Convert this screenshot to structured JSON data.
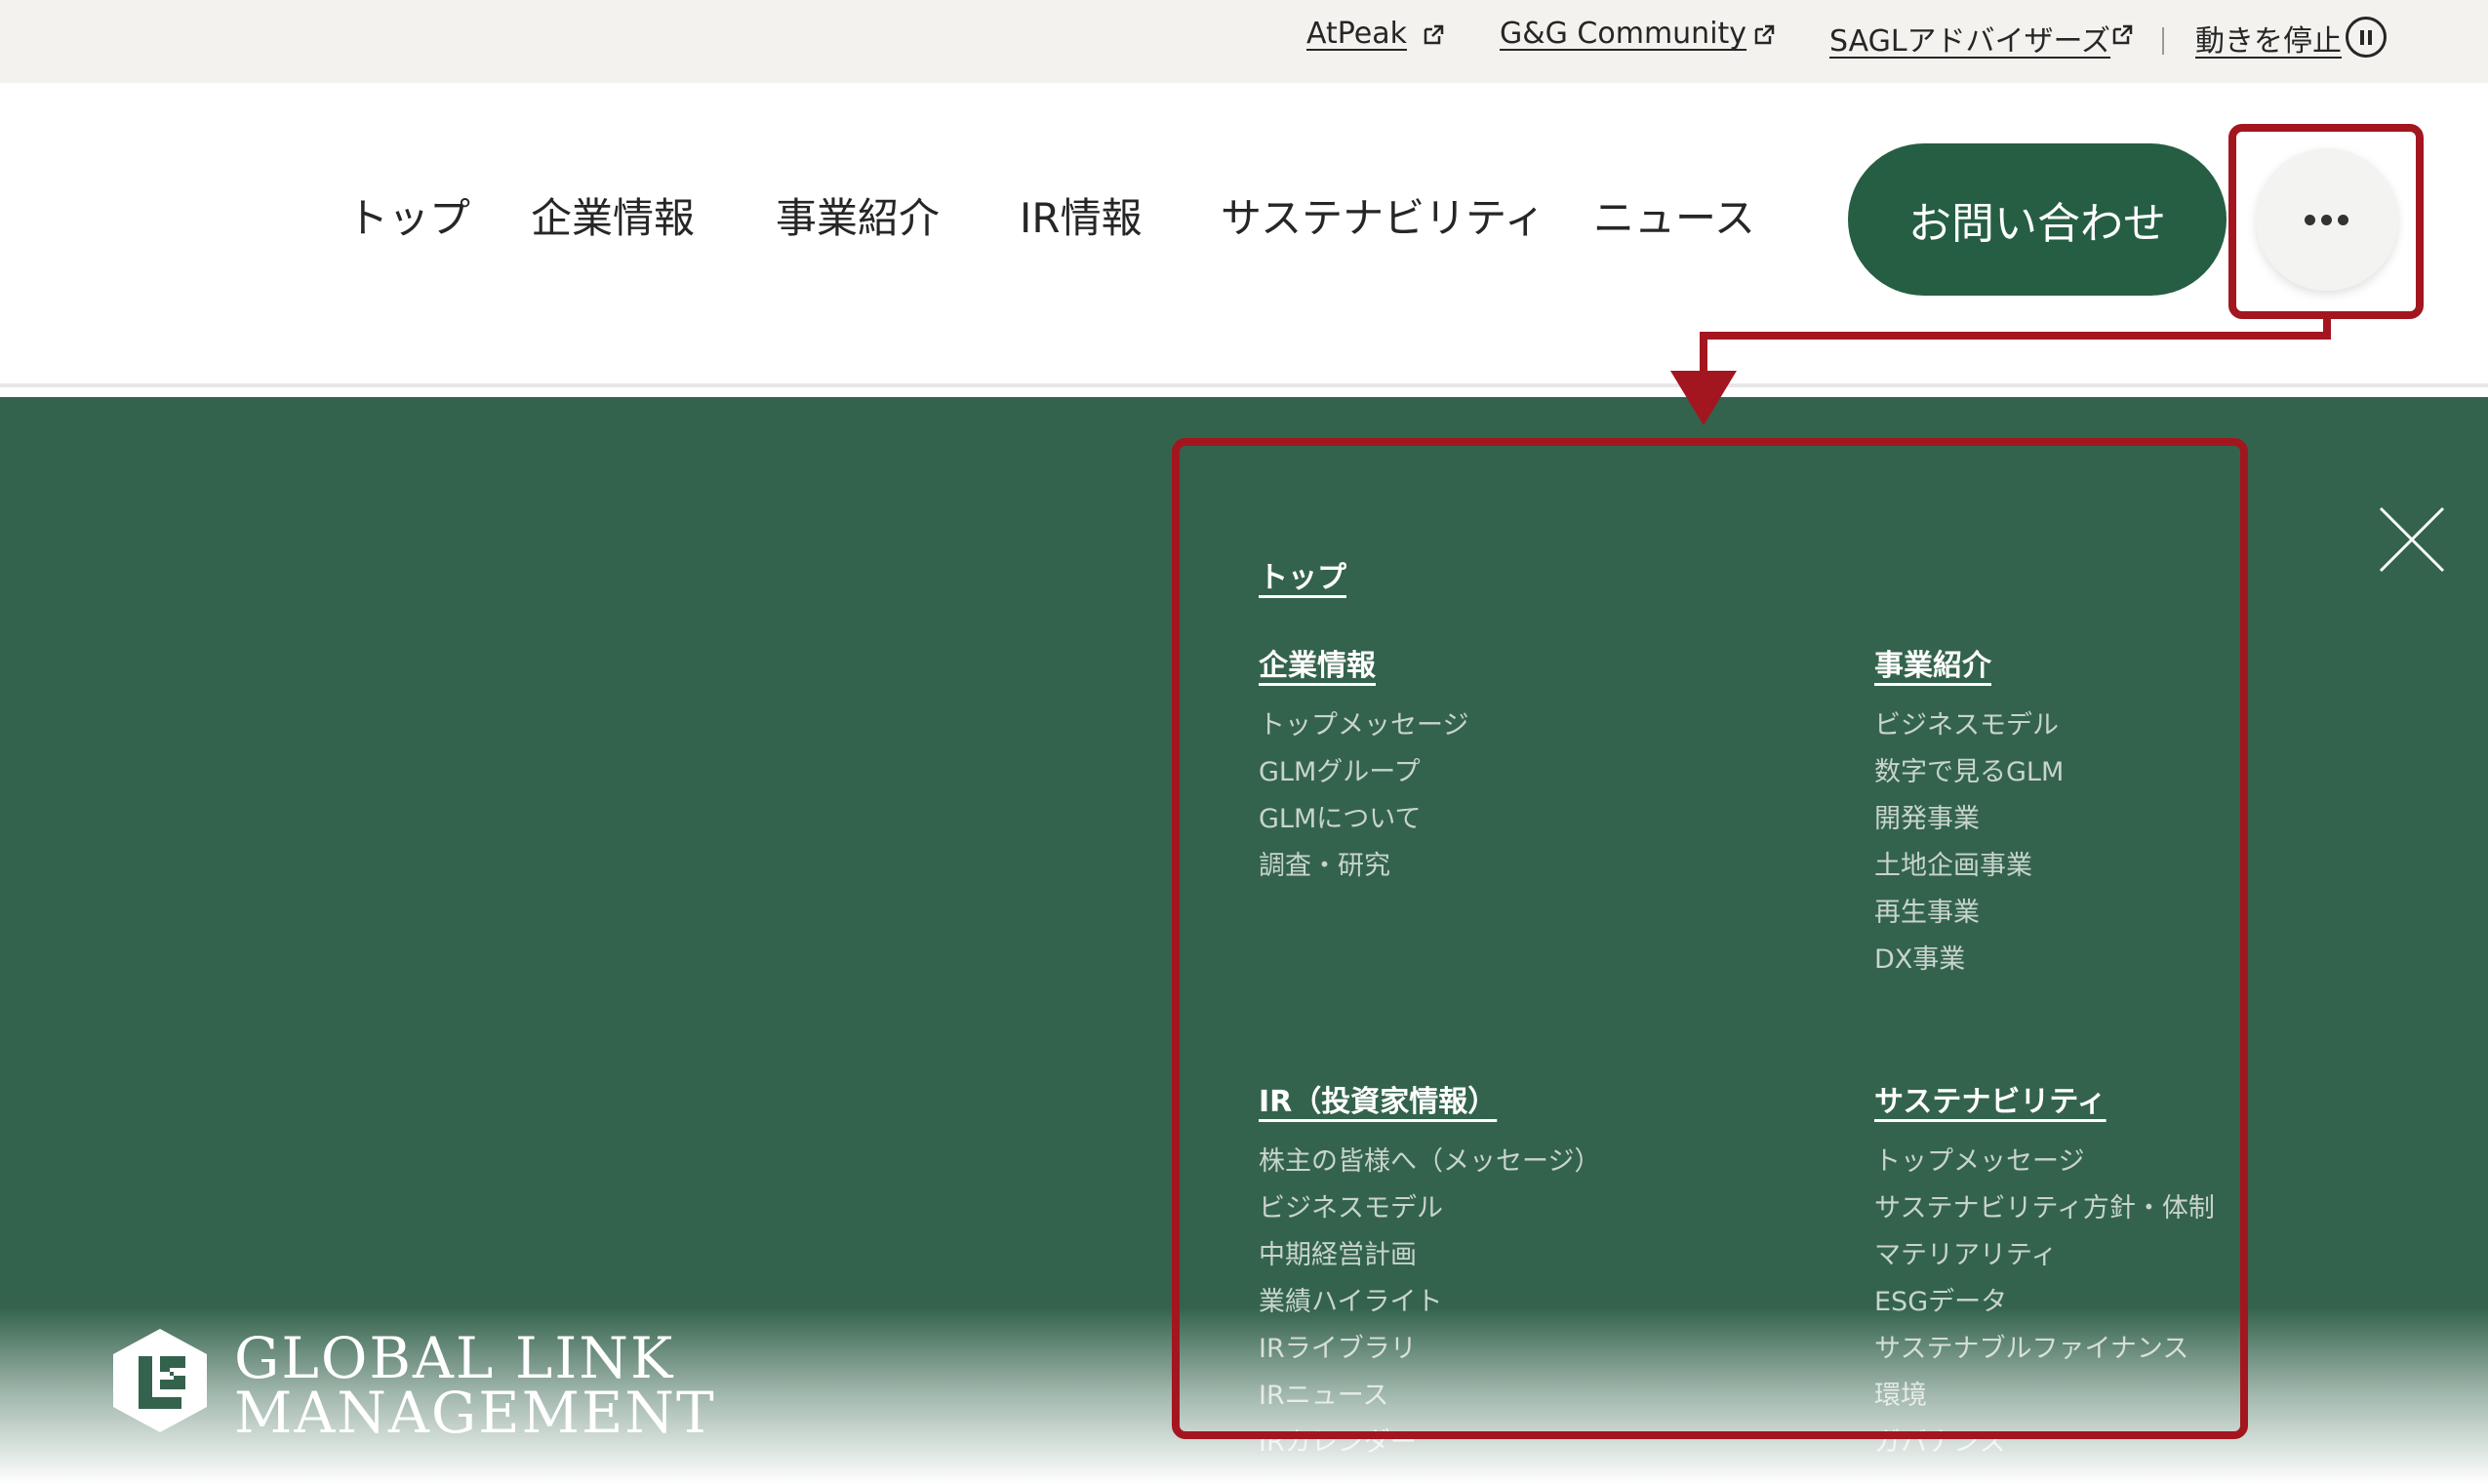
{
  "utility_bar": {
    "links": [
      {
        "label": "AtPeak"
      },
      {
        "label": "G&G Community"
      },
      {
        "label": "SAGLアドバイザーズ"
      }
    ],
    "pause_label": "動きを停止"
  },
  "header": {
    "nav": [
      "トップ",
      "企業情報",
      "事業紹介",
      "IR情報",
      "サステナビリティ",
      "ニュース"
    ],
    "contact_label": "お問い合わせ",
    "more_icon": "ellipsis-icon"
  },
  "menu": {
    "top": "トップ",
    "sections": [
      {
        "heading": "企業情報",
        "items": [
          "トップメッセージ",
          "GLMグループ",
          "GLMについて",
          "調査・研究"
        ]
      },
      {
        "heading": "事業紹介",
        "items": [
          "ビジネスモデル",
          "数字で見るGLM",
          "開発事業",
          "土地企画事業",
          "再生事業",
          "DX事業"
        ]
      },
      {
        "heading": "IR（投資家情報）",
        "items": [
          "株主の皆様へ（メッセージ）",
          "ビジネスモデル",
          "中期経営計画",
          "業績ハイライト",
          "IRライブラリ",
          "IRニュース",
          "IRカレンダー"
        ]
      },
      {
        "heading": "サステナビリティ",
        "items": [
          "トップメッセージ",
          "サステナビリティ方針・体制",
          "マテリアリティ",
          "ESGデータ",
          "サステナブルファイナンス",
          "環境",
          "ガバナンス"
        ]
      }
    ]
  },
  "logo": {
    "line1": "GLOBAL LINK",
    "line2": "MANAGEMENT"
  },
  "colors": {
    "brand_green": "#255e43",
    "overlay_green": "#34634d",
    "annotation_red": "#a3161f"
  }
}
